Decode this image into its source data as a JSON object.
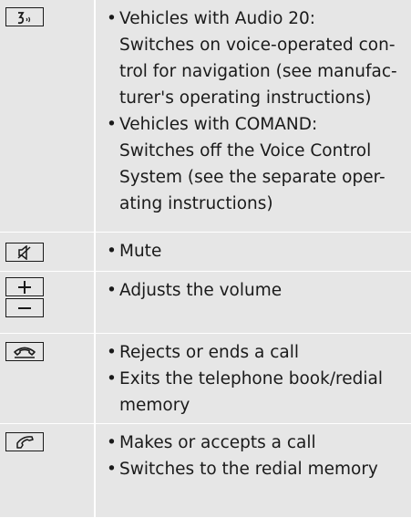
{
  "rows": [
    {
      "icon": "voice-control-icon",
      "items": [
        {
          "text": "Vehicles with Audio 20:",
          "sub": [
            "Switches on voice-operated con-",
            "trol for navigation (see manufac-",
            "turer's operating instructions)"
          ]
        },
        {
          "text": "Vehicles with COMAND:",
          "sub": [
            "Switches off the Voice Control",
            "System (see the separate oper-",
            "ating instructions)"
          ]
        }
      ]
    },
    {
      "icon": "mute-icon",
      "items": [
        {
          "text": "Mute"
        }
      ]
    },
    {
      "icon": "volume-plus-minus-icon",
      "items": [
        {
          "text": "Adjusts the volume"
        }
      ]
    },
    {
      "icon": "end-call-icon",
      "items": [
        {
          "text": "Rejects or ends a call"
        },
        {
          "text": "Exits the telephone book/redial",
          "cont": "memory"
        }
      ]
    },
    {
      "icon": "accept-call-icon",
      "items": [
        {
          "text": "Makes or accepts a call"
        },
        {
          "text": "Switches to the redial memory"
        }
      ]
    }
  ]
}
